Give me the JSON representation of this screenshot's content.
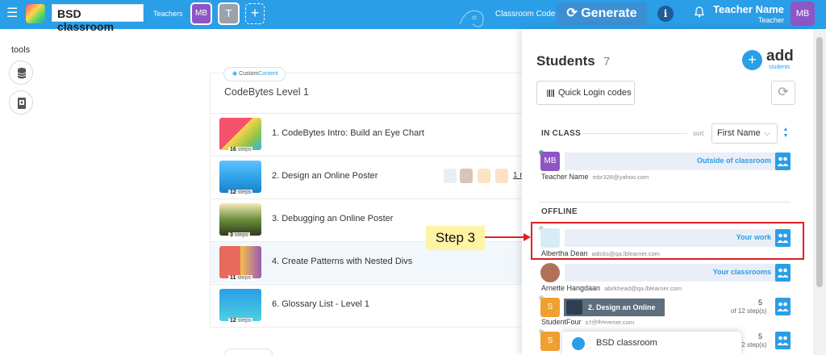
{
  "topbar": {
    "class_name": "BSD classroom",
    "teachers_label": "Teachers",
    "teacher_avatars": [
      "MB",
      "T"
    ],
    "add_teacher_symbol": "+",
    "classroom_code_label": "Classroom Code",
    "generate_label": "Generate",
    "info_symbol": "i",
    "user_name": "Teacher Name",
    "user_role": "Teacher",
    "user_initials": "MB",
    "colors": {
      "bar": "#2a9ee6",
      "avatar": "#8e56c5"
    }
  },
  "tools": {
    "label": "tools",
    "items": [
      "database-icon",
      "reader-icon"
    ]
  },
  "content": {
    "badge_prefix": "Custom",
    "badge_accent": "Content",
    "level_title": "CodeBytes Level 1",
    "lessons": [
      {
        "title": "1. CodeBytes Intro: Build an Eye Chart",
        "steps": "16",
        "steps_label": "steps"
      },
      {
        "title": "2. Design an Online Poster",
        "steps": "12",
        "steps_label": "steps"
      },
      {
        "title": "3. Debugging an Online Poster",
        "steps": "3",
        "steps_label": "steps"
      },
      {
        "title": "4. Create Patterns with Nested Divs",
        "steps": "11",
        "steps_label": "steps"
      },
      {
        "title": "6. Glossary List - Level 1",
        "steps": "12",
        "steps_label": "steps"
      }
    ],
    "lesson_row_link": "1 r"
  },
  "students_panel": {
    "title": "Students",
    "count": "7",
    "add_label": "add",
    "add_sub": "students",
    "quick_login_label": "Quick Login codes",
    "in_class_label": "IN CLASS",
    "sort_label": "sort",
    "sort_value": "First Name",
    "offline_label": "OFFLINE",
    "students": [
      {
        "name": "Teacher Name",
        "email": "mbr328@yahoo.com",
        "status": "Outside of classroom",
        "avatar": "MB"
      },
      {
        "name": "Albertha Dean",
        "email": "adicks@qa.lblearner.com",
        "status": "Your work"
      },
      {
        "name": "Arnette Hangdaan",
        "email": "abirkhead@qa.lblearner.com",
        "status": "Your classrooms"
      },
      {
        "name": "StudentFour",
        "email": "s4@lblearner.com",
        "avatar": "S",
        "progress_num": "5",
        "progress_of": "of 12 step(s)"
      },
      {
        "name": "",
        "email": "",
        "avatar": "S",
        "progress_num": "5",
        "progress_of": "of 12 step(s)"
      }
    ]
  },
  "annotation": {
    "label": "Step 3"
  },
  "hover_tooltip": {
    "text": "2. Design an Online Poster"
  },
  "chat_popup": {
    "text": "BSD classroom"
  }
}
